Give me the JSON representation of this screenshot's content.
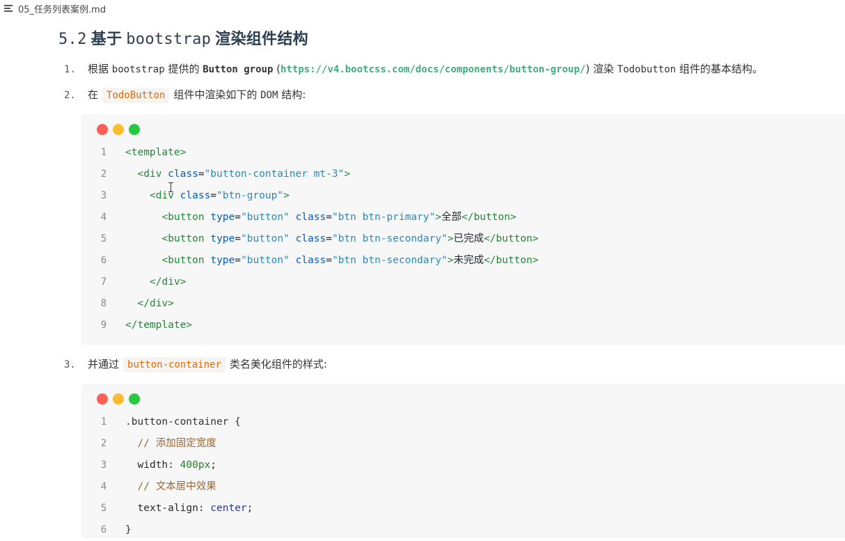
{
  "topbar": {
    "filename": "05_任务列表案例.md"
  },
  "heading": {
    "number": "5.2",
    "prefix": "基于",
    "keyword": "bootstrap",
    "suffix": "渲染组件结构"
  },
  "list": [
    {
      "marker": "1.",
      "parts": {
        "a": "根据",
        "b": "bootstrap",
        "c": "提供的",
        "d": "Button group",
        "e": "(",
        "link": "https://v4.bootcss.com/docs/components/button-group/",
        "f": ")",
        "g": "渲染",
        "h": "Todobutton",
        "i": "组件的基本结构。"
      }
    },
    {
      "marker": "2.",
      "parts": {
        "a": "在",
        "code": "TodoButton",
        "b": "组件中渲染如下的",
        "c": "DOM",
        "d": "结构:"
      }
    },
    {
      "marker": "3.",
      "parts": {
        "a": "并通过",
        "code": "button-container",
        "b": "类名美化组件的样式:"
      }
    }
  ],
  "code_block_1": {
    "lines": [
      {
        "n": "1",
        "t": [
          "<template>"
        ]
      },
      {
        "n": "2",
        "t": [
          "<div",
          "class",
          "=",
          "\"button-container mt-3\"",
          ">"
        ]
      },
      {
        "n": "3",
        "t": [
          "<div",
          "class",
          "=",
          "\"btn-group\"",
          ">"
        ]
      },
      {
        "n": "4",
        "t": [
          "<button",
          "type",
          "=",
          "\"button\"",
          "class",
          "=",
          "\"btn btn-primary\"",
          ">",
          "全部",
          "</button>"
        ]
      },
      {
        "n": "5",
        "t": [
          "<button",
          "type",
          "=",
          "\"button\"",
          "class",
          "=",
          "\"btn btn-secondary\"",
          ">",
          "已完成",
          "</button>"
        ]
      },
      {
        "n": "6",
        "t": [
          "<button",
          "type",
          "=",
          "\"button\"",
          "class",
          "=",
          "\"btn btn-secondary\"",
          ">",
          "未完成",
          "</button>"
        ]
      },
      {
        "n": "7",
        "t": [
          "</div>"
        ]
      },
      {
        "n": "8",
        "t": [
          "</div>"
        ]
      },
      {
        "n": "9",
        "t": [
          "</template>"
        ]
      }
    ]
  },
  "code_block_2": {
    "lines": [
      {
        "n": "1",
        "t": [
          ".button-container",
          "{"
        ]
      },
      {
        "n": "2",
        "t": [
          "// 添加固定宽度"
        ]
      },
      {
        "n": "3",
        "t": [
          "width",
          ":",
          "400px",
          ";"
        ]
      },
      {
        "n": "4",
        "t": [
          "// 文本居中效果"
        ]
      },
      {
        "n": "5",
        "t": [
          "text-align",
          ":",
          "center",
          ";"
        ]
      },
      {
        "n": "6",
        "t": [
          "}"
        ]
      }
    ]
  },
  "colors": {
    "heading": "#2c3e50",
    "link": "#3eaf7c",
    "inline_code": "#e96900",
    "tag": "#22863a",
    "attr": "#005cc5",
    "string": "#2a8ab5",
    "comment": "#996633",
    "dot_red": "#ff5f57",
    "dot_yellow": "#febc2e",
    "dot_green": "#28c840"
  },
  "icons": {
    "outline": "menu-lines-icon",
    "cursor": "text-cursor-icon"
  }
}
